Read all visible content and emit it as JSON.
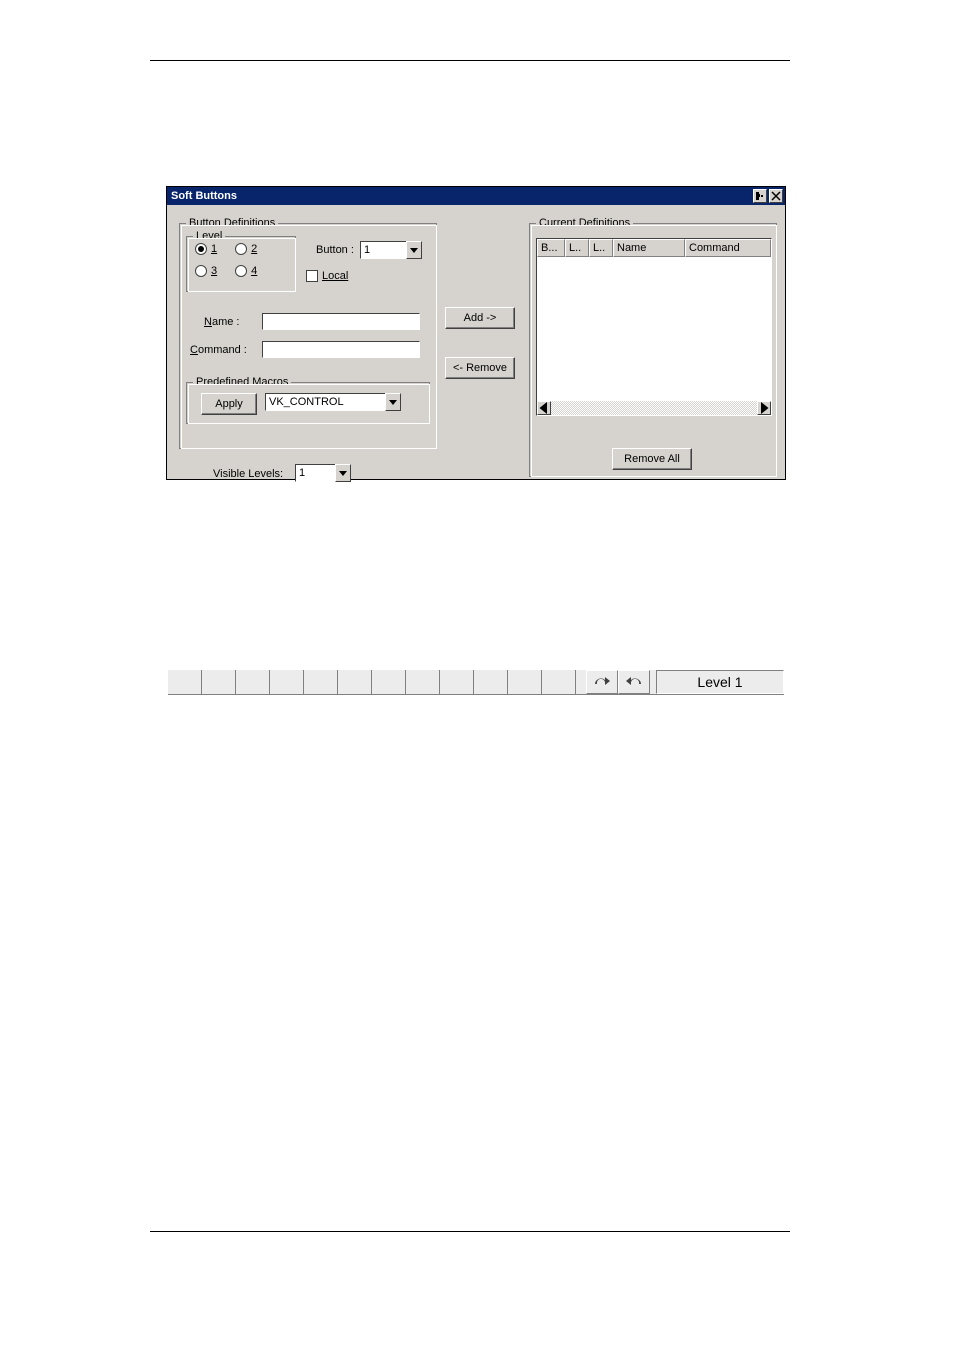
{
  "dialog": {
    "title": "Soft Buttons",
    "titlebar_buttons": {
      "help": "?",
      "close": "×"
    },
    "button_definitions": {
      "legend": "Button Definitions",
      "level": {
        "legend": "Level",
        "options": {
          "r1": "1",
          "r2": "2",
          "r3": "3",
          "r4": "4"
        },
        "selected": "1"
      },
      "button_label": "Button :",
      "button_value": "1",
      "local_label": "Local",
      "name_label": "Name :",
      "name_value": "",
      "command_label": "Command :",
      "command_value": "",
      "macros": {
        "legend": "Predefined Macros",
        "apply_label": "Apply",
        "macro_value": "VK_CONTROL"
      }
    },
    "add_label": "Add ->",
    "remove_label": "<- Remove",
    "current": {
      "legend": "Current Definitions",
      "columns": {
        "c1": "B...",
        "c2": "L..",
        "c3": "L..",
        "c4": "Name",
        "c5": "Command"
      },
      "remove_all_label": "Remove All"
    },
    "visible_levels_label": "Visible Levels:",
    "visible_levels_value": "1"
  },
  "softbar": {
    "level_text": "Level 1"
  }
}
